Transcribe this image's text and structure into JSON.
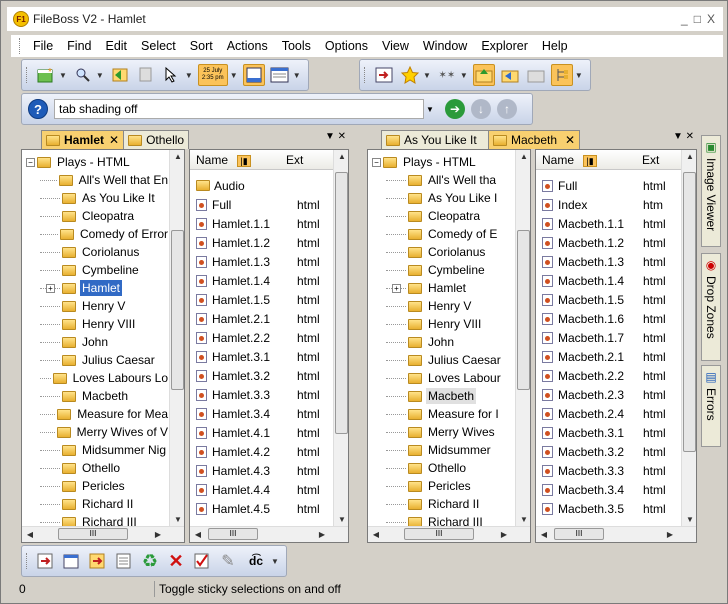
{
  "window": {
    "title": "FileBoss V2 - Hamlet",
    "app_icon": "F1",
    "controls": [
      "_",
      "□",
      "X"
    ]
  },
  "menu": [
    "File",
    "Find",
    "Edit",
    "Select",
    "Sort",
    "Actions",
    "Tools",
    "Options",
    "View",
    "Window",
    "Explorer",
    "Help"
  ],
  "toolbar": {
    "date_badge": "25 July\n2:35 pm"
  },
  "address": {
    "value": "tab shading off"
  },
  "left": {
    "tabs": [
      "Hamlet",
      "Othello"
    ],
    "tree_root": "Plays - HTML",
    "tree": [
      "All's Well that En",
      "As You Like It",
      "Cleopatra",
      "Comedy of Error",
      "Coriolanus",
      "Cymbeline",
      "Hamlet",
      "Henry V",
      "Henry VIII",
      "John",
      "Julius Caesar",
      "Loves Labours Lo",
      "Macbeth",
      "Measure for Mea",
      "Merry Wives of V",
      "Midsummer Nig",
      "Othello",
      "Pericles",
      "Richard II",
      "Richard III"
    ],
    "cols": {
      "name": "Name",
      "ext": "Ext"
    },
    "files": [
      [
        "Audio",
        ""
      ],
      [
        "Full",
        "html"
      ],
      [
        "Hamlet.1.1",
        "html"
      ],
      [
        "Hamlet.1.2",
        "html"
      ],
      [
        "Hamlet.1.3",
        "html"
      ],
      [
        "Hamlet.1.4",
        "html"
      ],
      [
        "Hamlet.1.5",
        "html"
      ],
      [
        "Hamlet.2.1",
        "html"
      ],
      [
        "Hamlet.2.2",
        "html"
      ],
      [
        "Hamlet.3.1",
        "html"
      ],
      [
        "Hamlet.3.2",
        "html"
      ],
      [
        "Hamlet.3.3",
        "html"
      ],
      [
        "Hamlet.3.4",
        "html"
      ],
      [
        "Hamlet.4.1",
        "html"
      ],
      [
        "Hamlet.4.2",
        "html"
      ],
      [
        "Hamlet.4.3",
        "html"
      ],
      [
        "Hamlet.4.4",
        "html"
      ],
      [
        "Hamlet.4.5",
        "html"
      ]
    ]
  },
  "right": {
    "tabs": [
      "As You Like It",
      "Macbeth"
    ],
    "tree_root": "Plays - HTML",
    "tree": [
      "All's Well tha",
      "As You Like I",
      "Cleopatra",
      "Comedy of E",
      "Coriolanus",
      "Cymbeline",
      "Hamlet",
      "Henry V",
      "Henry VIII",
      "John",
      "Julius Caesar",
      "Loves Labour",
      "Macbeth",
      "Measure for I",
      "Merry Wives",
      "Midsummer",
      "Othello",
      "Pericles",
      "Richard II",
      "Richard III"
    ],
    "cols": {
      "name": "Name",
      "ext": "Ext"
    },
    "files": [
      [
        "Full",
        "html"
      ],
      [
        "Index",
        "htm"
      ],
      [
        "Macbeth.1.1",
        "html"
      ],
      [
        "Macbeth.1.2",
        "html"
      ],
      [
        "Macbeth.1.3",
        "html"
      ],
      [
        "Macbeth.1.4",
        "html"
      ],
      [
        "Macbeth.1.5",
        "html"
      ],
      [
        "Macbeth.1.6",
        "html"
      ],
      [
        "Macbeth.1.7",
        "html"
      ],
      [
        "Macbeth.2.1",
        "html"
      ],
      [
        "Macbeth.2.2",
        "html"
      ],
      [
        "Macbeth.2.3",
        "html"
      ],
      [
        "Macbeth.2.4",
        "html"
      ],
      [
        "Macbeth.3.1",
        "html"
      ],
      [
        "Macbeth.3.2",
        "html"
      ],
      [
        "Macbeth.3.3",
        "html"
      ],
      [
        "Macbeth.3.4",
        "html"
      ],
      [
        "Macbeth.3.5",
        "html"
      ]
    ]
  },
  "side_tabs": [
    "Image Viewer",
    "Drop Zones",
    "Errors"
  ],
  "status": {
    "left": "0",
    "message": "Toggle sticky selections on and off"
  },
  "scroll_glyph": "III"
}
